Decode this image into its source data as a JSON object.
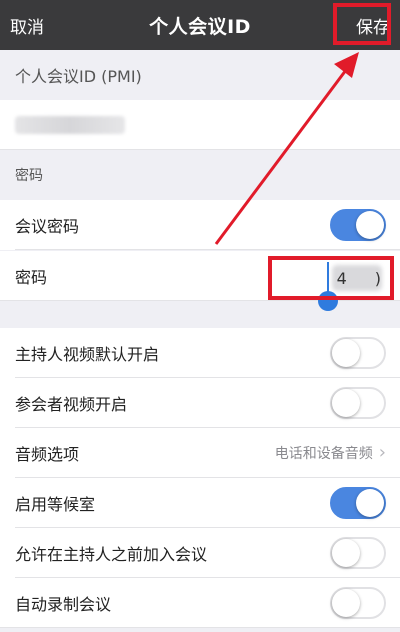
{
  "nav": {
    "cancel": "取消",
    "title": "个人会议ID",
    "save": "保存"
  },
  "pmi": {
    "header": "个人会议ID (PMI)"
  },
  "password_section": {
    "header": "密码",
    "meeting_password_label": "会议密码",
    "meeting_password_on": true,
    "password_label": "密码",
    "password_visible_char": "4",
    "password_tail_char": ")"
  },
  "settings": {
    "host_video_label": "主持人视频默认开启",
    "host_video_on": false,
    "participant_video_label": "参会者视频开启",
    "participant_video_on": false,
    "audio_label": "音频选项",
    "audio_value": "电话和设备音频",
    "waiting_room_label": "启用等候室",
    "waiting_room_on": true,
    "join_before_host_label": "允许在主持人之前加入会议",
    "join_before_host_on": false,
    "auto_record_label": "自动录制会议",
    "auto_record_on": false
  },
  "colors": {
    "toggle_on": "#4a86e0",
    "highlight": "#e11b2a",
    "navbar": "#3a3a3c"
  },
  "icons": [
    "chevron-right-icon"
  ]
}
